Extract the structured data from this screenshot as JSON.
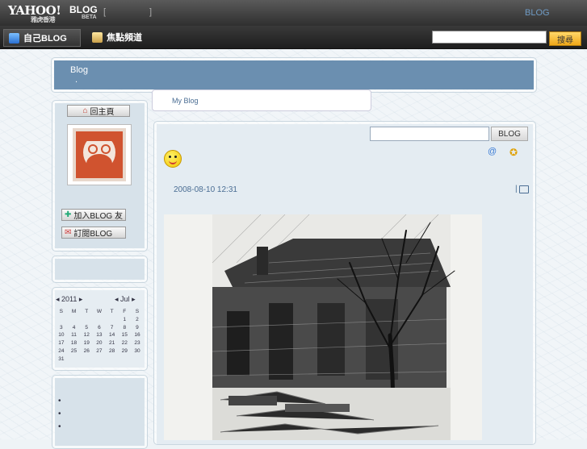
{
  "topbar": {
    "logo": "YAHOO!",
    "logo_sub": "雅虎香港",
    "logo_blog": "BLOG",
    "logo_beta": "BETA",
    "bracket_left": "[",
    "bracket_right": "]",
    "right_link": "BLOG"
  },
  "navbar": {
    "my_blog": "自己BLOG",
    "focus_channel": "焦點頻道",
    "search_button": "搜尋",
    "search_value": ""
  },
  "header": {
    "title": "Blog",
    "subtitle": "."
  },
  "tab": {
    "label": "My Blog"
  },
  "sidebar": {
    "home_button": "回主頁",
    "add_friend_button": "加入BLOG 友",
    "subscribe_button": "訂閱BLOG",
    "calendar": {
      "year": "2011",
      "month": "Jul",
      "weekdays": [
        "S",
        "M",
        "T",
        "W",
        "T",
        "F",
        "S"
      ],
      "weeks": [
        [
          "",
          "",
          "",
          "",
          "",
          "1",
          "2"
        ],
        [
          "3",
          "4",
          "5",
          "6",
          "7",
          "8",
          "9"
        ],
        [
          "10",
          "11",
          "12",
          "13",
          "14",
          "15",
          "16"
        ],
        [
          "17",
          "18",
          "19",
          "20",
          "21",
          "22",
          "23"
        ],
        [
          "24",
          "25",
          "26",
          "27",
          "28",
          "29",
          "30"
        ],
        [
          "31",
          "",
          "",
          "",
          "",
          "",
          ""
        ]
      ]
    },
    "bullets": [
      "•",
      "•",
      "•"
    ]
  },
  "main": {
    "search_value": "",
    "search_button": "BLOG",
    "post_date": "2008-08-10 12:31",
    "post_meta": "|"
  },
  "colors": {
    "header_bg": "#6b8fb0",
    "link": "#4a6d93",
    "search_button": "#f0a818"
  }
}
